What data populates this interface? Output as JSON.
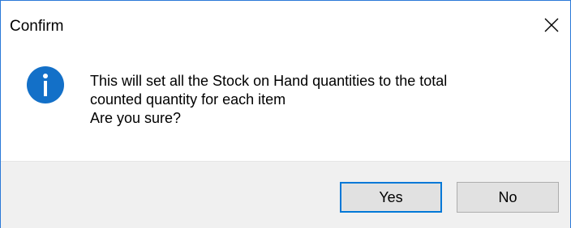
{
  "dialog": {
    "title": "Confirm",
    "message_lines": [
      "This will set all the Stock on Hand quantities to the total",
      "counted quantity for each item",
      "Are you sure?"
    ],
    "icon": "info-icon",
    "buttons": {
      "yes_label": "Yes",
      "no_label": "No"
    },
    "default_button": "yes",
    "close_icon": "close-icon"
  },
  "colors": {
    "accent": "#0078d7",
    "icon_fill": "#1370c8",
    "footer_bg": "#f0f0f0",
    "button_bg": "#e1e1e1"
  }
}
